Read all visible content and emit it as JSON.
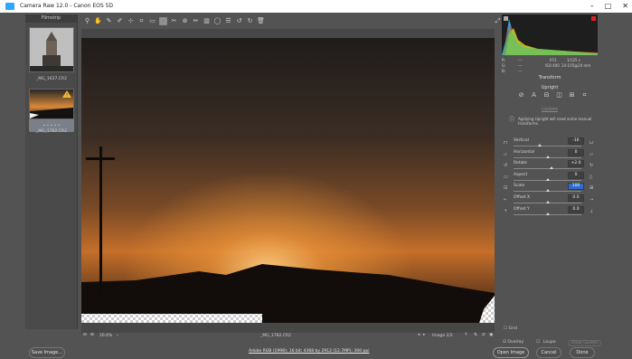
{
  "window": {
    "title": "Camera Raw 12.0  -  Canon EOS 5D",
    "controls": [
      "–",
      "□",
      "✕"
    ]
  },
  "filmstrip": {
    "title": "Filmstrip",
    "items": [
      {
        "label": "_MG_1637.CR2",
        "selected": false
      },
      {
        "label": "_MG_1782.CR2",
        "selected": true,
        "rating": "• • • • •"
      }
    ]
  },
  "toolbar": {
    "tools": [
      "zoom-icon",
      "hand-icon",
      "white-balance-icon",
      "color-sampler-icon",
      "targeted-adjust-icon",
      "crop-icon",
      "straighten-icon",
      "transform-icon",
      "spot-removal-icon",
      "red-eye-icon",
      "adjustment-brush-icon",
      "graduated-filter-icon",
      "radial-filter-icon",
      "preferences-icon",
      "rotate-ccw-icon",
      "rotate-cw-icon",
      "trash-icon"
    ],
    "fullscreen": "fullscreen-icon"
  },
  "preview": {
    "filename": "_MG_1782.CR2",
    "zoom": "26.6%",
    "image_counter": "Image 2/2"
  },
  "histogram": {
    "readout": {
      "r": "R:",
      "g": "G:",
      "b": "B:",
      "r_val": "---",
      "g_val": "---",
      "b_val": "---",
      "aperture": "f/11",
      "shutter": "1/125 s",
      "iso": "ISO 400",
      "lens": "24-105@24 mm"
    }
  },
  "panel": {
    "section": "Transform",
    "upright": "Upright",
    "update": "Update",
    "note": "Applying Upright will reset some manual transforms.",
    "sliders": [
      {
        "label": "Vertical",
        "value": "-16",
        "pos": 0.38
      },
      {
        "label": "Horizontal",
        "value": "0",
        "pos": 0.5
      },
      {
        "label": "Rotate",
        "value": "+2.0",
        "pos": 0.56
      },
      {
        "label": "Aspect",
        "value": "0",
        "pos": 0.5
      },
      {
        "label": "Scale",
        "value": "100",
        "pos": 0.5,
        "highlight": true
      },
      {
        "label": "Offset X",
        "value": "0.0",
        "pos": 0.5
      },
      {
        "label": "Offset Y",
        "value": "0.0",
        "pos": 0.5
      }
    ],
    "grid": "Grid",
    "overlay": "Overlay",
    "loupe": "Loupe",
    "clear_guides": "Clear Guides"
  },
  "footer": {
    "save": "Save Image...",
    "workflow": "Adobe RGB (1998); 16 bit; 4368 by 2912 (12.7MP); 300 ppi",
    "open": "Open Image",
    "cancel": "Cancel",
    "done": "Done"
  }
}
